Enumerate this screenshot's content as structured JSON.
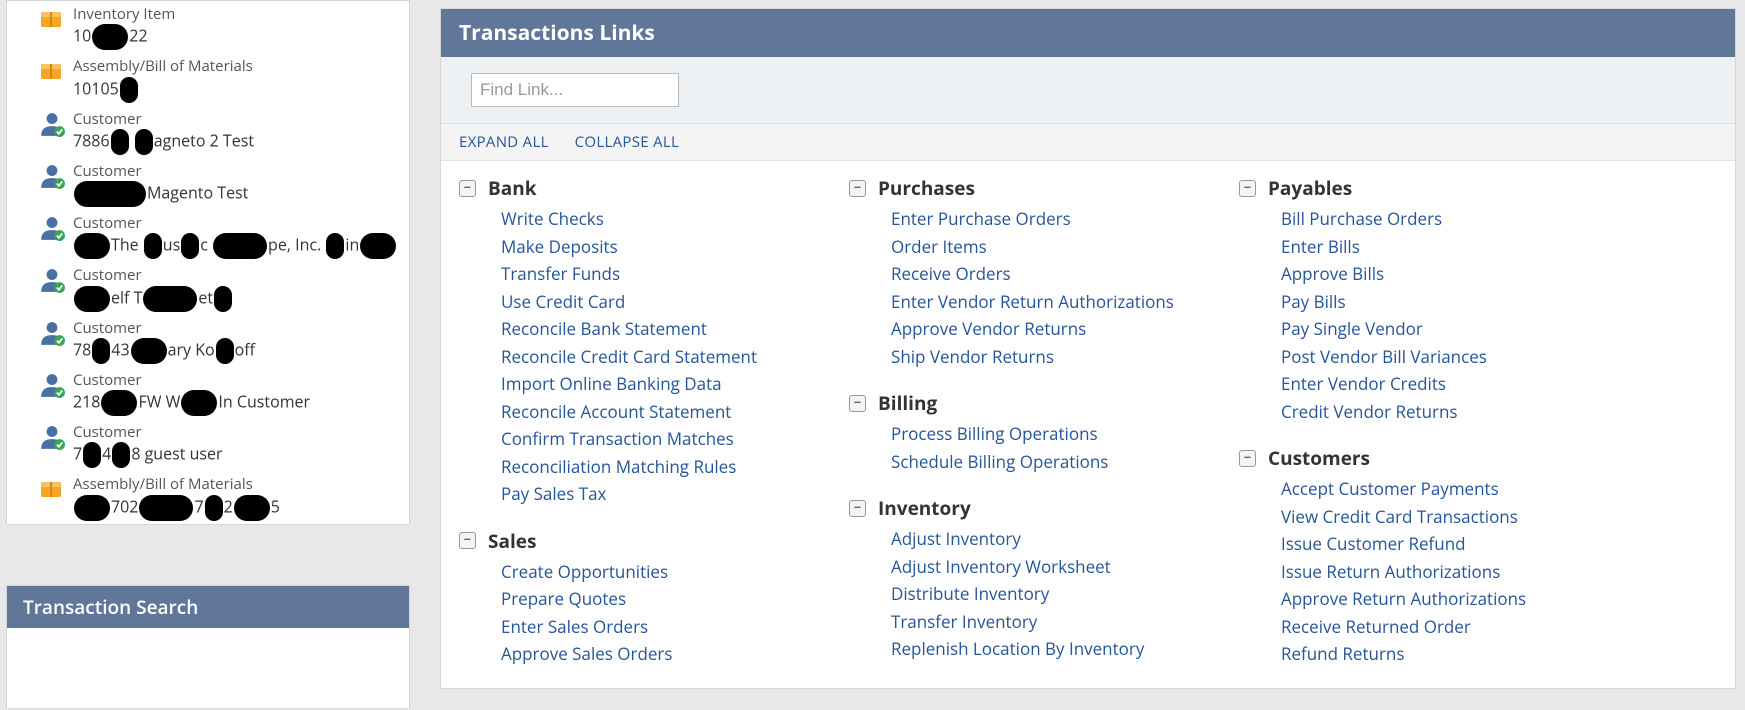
{
  "sidebar": {
    "records": [
      {
        "icon": "box",
        "type": "Inventory Item",
        "detail": "10●●22"
      },
      {
        "icon": "box",
        "type": "Assembly/Bill of Materials",
        "detail": "10105●"
      },
      {
        "icon": "person",
        "type": "Customer",
        "detail": "7886● ●agneto 2 Test"
      },
      {
        "icon": "person",
        "type": "Customer",
        "detail": "●●●●Magento Test"
      },
      {
        "icon": "person",
        "type": "Customer",
        "detail": "●●The ●us●c ●●●pe, Inc. ●in●●"
      },
      {
        "icon": "person",
        "type": "Customer",
        "detail": "●●elf T●●●et●"
      },
      {
        "icon": "person",
        "type": "Customer",
        "detail": "78●43●●ary Ko●off"
      },
      {
        "icon": "person",
        "type": "Customer",
        "detail": "218●●FW W●●In Customer"
      },
      {
        "icon": "person",
        "type": "Customer",
        "detail": "7●4●8 guest user"
      },
      {
        "icon": "box",
        "type": "Assembly/Bill of Materials",
        "detail": "●●702●●●7●2●●5"
      }
    ]
  },
  "search_portlet": {
    "title": "Transaction Search"
  },
  "main": {
    "title": "Transactions Links",
    "find_placeholder": "Find Link...",
    "expand_all": "EXPAND ALL",
    "collapse_all": "COLLAPSE ALL",
    "columns": [
      {
        "sections": [
          {
            "title": "Bank",
            "links": [
              "Write Checks",
              "Make Deposits",
              "Transfer Funds",
              "Use Credit Card",
              "Reconcile Bank Statement",
              "Reconcile Credit Card Statement",
              "Import Online Banking Data",
              "Reconcile Account Statement",
              "Confirm Transaction Matches",
              "Reconciliation Matching Rules",
              "Pay Sales Tax"
            ]
          },
          {
            "title": "Sales",
            "links": [
              "Create Opportunities",
              "Prepare Quotes",
              "Enter Sales Orders",
              "Approve Sales Orders"
            ]
          }
        ]
      },
      {
        "sections": [
          {
            "title": "Purchases",
            "links": [
              "Enter Purchase Orders",
              "Order Items",
              "Receive Orders",
              "Enter Vendor Return Authorizations",
              "Approve Vendor Returns",
              "Ship Vendor Returns"
            ]
          },
          {
            "title": "Billing",
            "links": [
              "Process Billing Operations",
              "Schedule Billing Operations"
            ]
          },
          {
            "title": "Inventory",
            "links": [
              "Adjust Inventory",
              "Adjust Inventory Worksheet",
              "Distribute Inventory",
              "Transfer Inventory",
              "Replenish Location By Inventory"
            ]
          }
        ]
      },
      {
        "sections": [
          {
            "title": "Payables",
            "links": [
              "Bill Purchase Orders",
              "Enter Bills",
              "Approve Bills",
              "Pay Bills",
              "Pay Single Vendor",
              "Post Vendor Bill Variances",
              "Enter Vendor Credits",
              "Credit Vendor Returns"
            ]
          },
          {
            "title": "Customers",
            "links": [
              "Accept Customer Payments",
              "View Credit Card Transactions",
              "Issue Customer Refund",
              "Issue Return Authorizations",
              "Approve Return Authorizations",
              "Receive Returned Order",
              "Refund Returns"
            ]
          }
        ]
      }
    ]
  }
}
